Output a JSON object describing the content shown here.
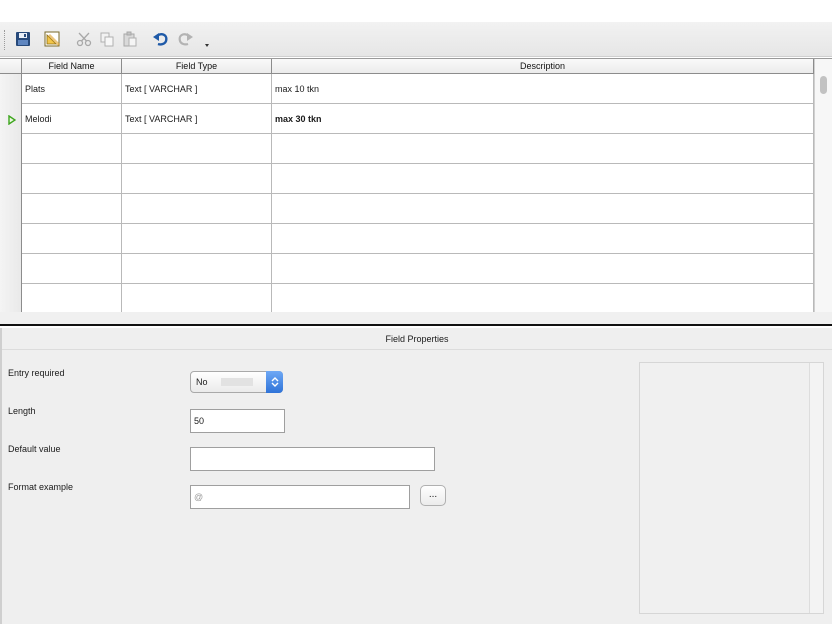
{
  "toolbar": {
    "buttons": [
      {
        "icon": "save-icon"
      },
      {
        "icon": "edit-icon"
      },
      {
        "icon": "cut-icon"
      },
      {
        "icon": "copy-icon"
      },
      {
        "icon": "paste-icon"
      },
      {
        "icon": "undo-icon"
      },
      {
        "icon": "redo-icon"
      }
    ]
  },
  "grid": {
    "columns": [
      "Field Name",
      "Field Type",
      "Description"
    ],
    "rows": [
      {
        "name": "Plats",
        "type": "Text [ VARCHAR ]",
        "description": "max 10 tkn",
        "current": false
      },
      {
        "name": "Melodi",
        "type": "Text [ VARCHAR ]",
        "description": "max 30 tkn",
        "current": true
      }
    ]
  },
  "props": {
    "title": "Field Properties",
    "entry_required_label": "Entry required",
    "entry_required_value": "No",
    "length_label": "Length",
    "length_value": "50",
    "default_label": "Default value",
    "default_value": "",
    "format_label": "Format example",
    "format_value": "@",
    "format_button": "..."
  },
  "colors": {
    "accent": "#2f73d8",
    "current_row_marker": "#3ca51c"
  }
}
